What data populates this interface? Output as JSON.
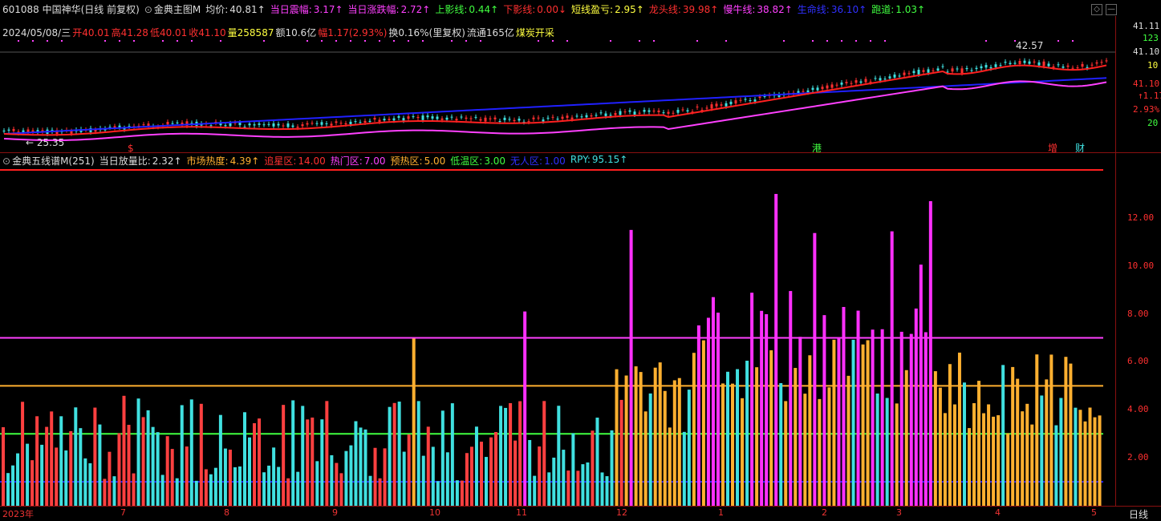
{
  "colors": {
    "red": "#ff3030",
    "green": "#20c020",
    "magenta": "#ff30ff",
    "blue": "#2020ff",
    "cyan": "#40e0e0",
    "orange": "#ffb030",
    "yellow": "#ffff40",
    "white": "#dddddd"
  },
  "header": {
    "stock": "601088 中国神华(日线 前复权)",
    "indicator": "金典主图M",
    "items": [
      {
        "label": "均价:",
        "value": "40.81↑",
        "color": "#dddddd"
      },
      {
        "label": "当日震幅:",
        "value": "3.17↑",
        "color": "#ff40ff"
      },
      {
        "label": "当日涨跌幅:",
        "value": "2.72↑",
        "color": "#ff40ff"
      },
      {
        "label": "上影线:",
        "value": "0.44↑",
        "color": "#40ff40"
      },
      {
        "label": "下影线:",
        "value": "0.00↓",
        "color": "#ff3030"
      },
      {
        "label": "短线盈亏:",
        "value": "2.95↑",
        "color": "#ffff40"
      },
      {
        "label": "龙头线:",
        "value": "39.98↑",
        "color": "#ff3030"
      },
      {
        "label": "慢牛线:",
        "value": "38.82↑",
        "color": "#ff40ff"
      },
      {
        "label": "生命线:",
        "value": "36.10↑",
        "color": "#3030ff"
      },
      {
        "label": "跑道:",
        "value": "1.03↑",
        "color": "#40ff40"
      }
    ]
  },
  "info": {
    "date": "2024/05/08/三",
    "open": "开40.01",
    "high": "高41.28",
    "low": "低40.01",
    "close": "收41.10",
    "volume": "量258587",
    "amount": "额10.6亿",
    "change": "幅1.17(2.93%)",
    "turnover": "换0.16%(里复权)",
    "float": "流通165亿",
    "sector": "煤炭开采"
  },
  "upper_axis": [
    "41.11",
    "123",
    "41.10",
    "10",
    "41.10",
    "↑1.17",
    "2.93%",
    "20"
  ],
  "upper_annotations": {
    "high_label": "42.57",
    "low_label": "← 25.35",
    "s_mark": "$",
    "gang": "港",
    "zeng": "增",
    "cai": "财"
  },
  "lower": {
    "indicator": "金典五线谱M(251)",
    "items": [
      {
        "label": "当日放量比:",
        "value": "2.32↑",
        "color": "#dddddd"
      },
      {
        "label": "市场热度:",
        "value": "4.39↑",
        "color": "#ffb030"
      },
      {
        "label": "追星区:",
        "value": "14.00",
        "color": "#ff3030"
      },
      {
        "label": "热门区:",
        "value": "7.00",
        "color": "#ff40ff"
      },
      {
        "label": "预热区:",
        "value": "5.00",
        "color": "#ffb030"
      },
      {
        "label": "低温区:",
        "value": "3.00",
        "color": "#40ff40"
      },
      {
        "label": "无人区:",
        "value": "1.00",
        "color": "#3030ff"
      },
      {
        "label": "RPY:",
        "value": "95.15↑",
        "color": "#40e0e0"
      }
    ],
    "ticks": [
      "12.00",
      "10.00",
      "8.00",
      "6.00",
      "4.00",
      "2.00"
    ]
  },
  "xaxis": [
    {
      "label": "2023年"
    },
    {
      "label": "7"
    },
    {
      "label": "8"
    },
    {
      "label": "9"
    },
    {
      "label": "10"
    },
    {
      "label": "11"
    },
    {
      "label": "12"
    },
    {
      "label": "1"
    },
    {
      "label": "2"
    },
    {
      "label": "3"
    },
    {
      "label": "4"
    },
    {
      "label": "5"
    }
  ],
  "period": "日线"
}
